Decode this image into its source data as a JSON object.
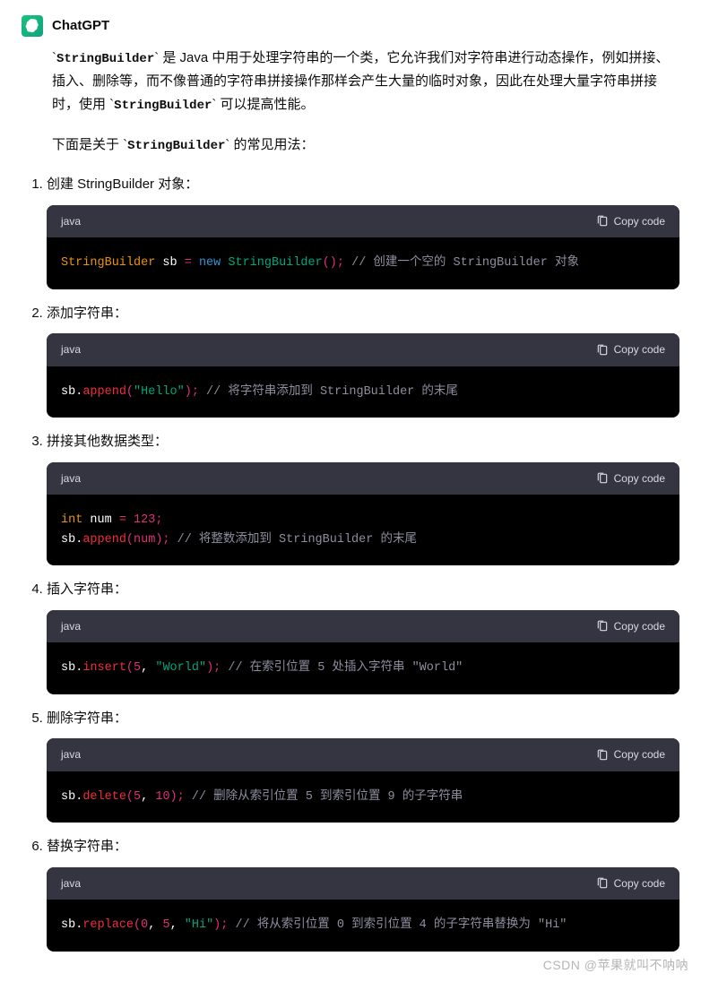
{
  "bot_name": "ChatGPT",
  "intro": {
    "p1_pre": "`",
    "p1_code1": "StringBuilder",
    "p1_mid1": "` 是 Java 中用于处理字符串的一个类，它允许我们对字符串进行动态操作，例如拼接、插入、删除等，而不像普通的字符串拼接操作那样会产生大量的临时对象，因此在处理大量字符串拼接时，使用 `",
    "p1_code2": "StringBuilder",
    "p1_suf": "` 可以提高性能。",
    "p2_pre": "下面是关于 `",
    "p2_code": "StringBuilder",
    "p2_suf": "` 的常见用法："
  },
  "copy_label": "Copy code",
  "lang_label": "java",
  "items": [
    {
      "title": "创建 StringBuilder 对象：",
      "code": {
        "t1": "StringBuilder",
        "t2": " sb ",
        "t3": "=",
        "t4": " ",
        "t5": "new",
        "t6": " ",
        "t7": "StringBuilder",
        "t8": "();",
        "t9": " // 创建一个空的 StringBuilder 对象"
      }
    },
    {
      "title": "添加字符串：",
      "code": {
        "t1": "sb.",
        "t2": "append",
        "t3": "(",
        "t4": "\"Hello\"",
        "t5": ");",
        "t6": " // 将字符串添加到 StringBuilder 的末尾"
      }
    },
    {
      "title": "拼接其他数据类型：",
      "code": {
        "l1_t1": "int",
        "l1_t2": " num ",
        "l1_t3": "=",
        "l1_t4": " ",
        "l1_t5": "123",
        "l1_t6": ";",
        "l2_t1": "sb.",
        "l2_t2": "append",
        "l2_t3": "(num);",
        "l2_t4": " // 将整数添加到 StringBuilder 的末尾"
      }
    },
    {
      "title": "插入字符串：",
      "code": {
        "t1": "sb.",
        "t2": "insert",
        "t3": "(",
        "t4": "5",
        "t5": ", ",
        "t6": "\"World\"",
        "t7": ");",
        "t8": " // 在索引位置 5 处插入字符串 \"World\""
      }
    },
    {
      "title": "删除字符串：",
      "code": {
        "t1": "sb.",
        "t2": "delete",
        "t3": "(",
        "t4": "5",
        "t5": ", ",
        "t6": "10",
        "t7": ");",
        "t8": " // 删除从索引位置 5 到索引位置 9 的子字符串"
      }
    },
    {
      "title": "替换字符串：",
      "code": {
        "t1": "sb.",
        "t2": "replace",
        "t3": "(",
        "t4": "0",
        "t5": ", ",
        "t6": "5",
        "t7": ", ",
        "t8": "\"Hi\"",
        "t9": ");",
        "t10": " // 将从索引位置 0 到索引位置 4 的子字符串替换为 \"Hi\""
      }
    }
  ],
  "watermark": "CSDN @苹果就叫不呐呐"
}
